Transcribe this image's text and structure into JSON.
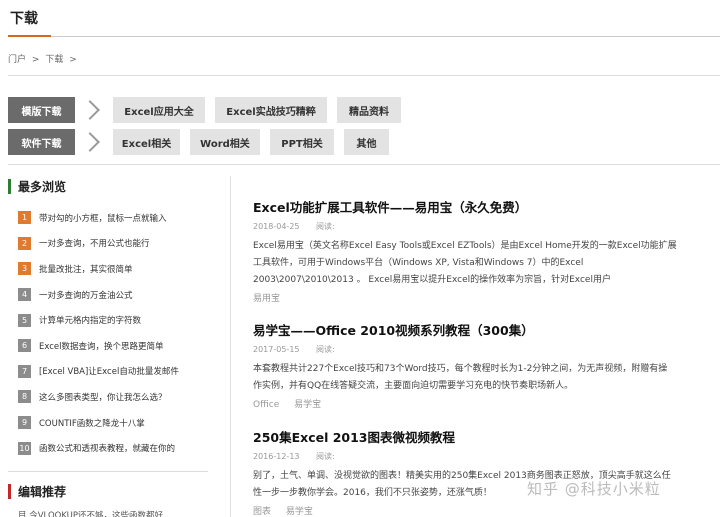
{
  "page": {
    "title": "下载"
  },
  "breadcrumb": {
    "home": "门户",
    "sep": ">",
    "current": "下载",
    "tail": ">"
  },
  "filters": {
    "templates": {
      "label": "模版下载",
      "items": [
        "Excel应用大全",
        "Excel实战技巧精粹",
        "精品资料"
      ]
    },
    "software": {
      "label": "软件下载",
      "items": [
        "Excel相关",
        "Word相关",
        "PPT相关",
        "其他"
      ]
    }
  },
  "sidebar": {
    "most_viewed": {
      "title": "最多浏览",
      "items": [
        {
          "num": "1",
          "text": "带对勾的小方框，鼠标一点就输入"
        },
        {
          "num": "2",
          "text": "一对多查询，不用公式也能行"
        },
        {
          "num": "3",
          "text": "批量改批注，其实很简单"
        },
        {
          "num": "4",
          "text": "一对多查询的万金油公式"
        },
        {
          "num": "5",
          "text": "计算单元格内指定的字符数"
        },
        {
          "num": "6",
          "text": "Excel数据查询，换个思路更简单"
        },
        {
          "num": "7",
          "text": "[Excel VBA]让Excel自动批量发邮件"
        },
        {
          "num": "8",
          "text": "这么多图表类型，你让我怎么选？"
        },
        {
          "num": "9",
          "text": "COUNTIF函数之降龙十八掌"
        },
        {
          "num": "10",
          "text": "函数公式和透视表教程，就藏在你的"
        }
      ]
    },
    "recommend": {
      "title": "编辑推荐",
      "partial": "目 今VLOOKUP还不够，这些函数都好"
    }
  },
  "articles": [
    {
      "title": "Excel功能扩展工具软件——易用宝（永久免费）",
      "date": "2018-04-25",
      "read": "阅读:",
      "lines": [
        "Excel易用宝（英文名称Excel Easy Tools或Excel EZTools）是由Excel Home开发的一款Excel功能扩展",
        "工具软件，可用于Windows平台（Windows XP, Vista和Windows 7）中的Excel",
        "2003\\2007\\2010\\2013 。 Excel易用宝以提升Excel的操作效率为宗旨，针对Excel用户"
      ],
      "tags": [
        "易用宝"
      ]
    },
    {
      "title": "易学宝——Office 2010视频系列教程（300集）",
      "date": "2017-05-15",
      "read": "阅读:",
      "lines": [
        "本套教程共计227个Excel技巧和73个Word技巧，每个教程时长为1-2分钟之间，为无声视频，附赠有操",
        "作实例，并有QQ在线答疑交流，主要面向迫切需要学习充电的快节奏职场新人。"
      ],
      "tags": [
        "Office",
        "易学宝"
      ]
    },
    {
      "title": "250集Excel 2013图表微视频教程",
      "date": "2016-12-13",
      "read": "阅读:",
      "lines": [
        "别了，土气、单调、没视觉欲的图表！精美实用的250集Excel 2013商务图表正怒放，顶尖高手就这么任",
        "性一步一步教你学会。2016，我们不只张姿势，还涨气质！"
      ],
      "tags": [
        "图表",
        "易学宝"
      ]
    }
  ],
  "watermark": "知乎 @科技小米粒",
  "colors": {
    "accent": "#d2691e",
    "chip": "#e3e3e3",
    "label": "#6b6b6b",
    "hot": "#e07a2e",
    "green": "#2e7d32",
    "red": "#c62828"
  }
}
